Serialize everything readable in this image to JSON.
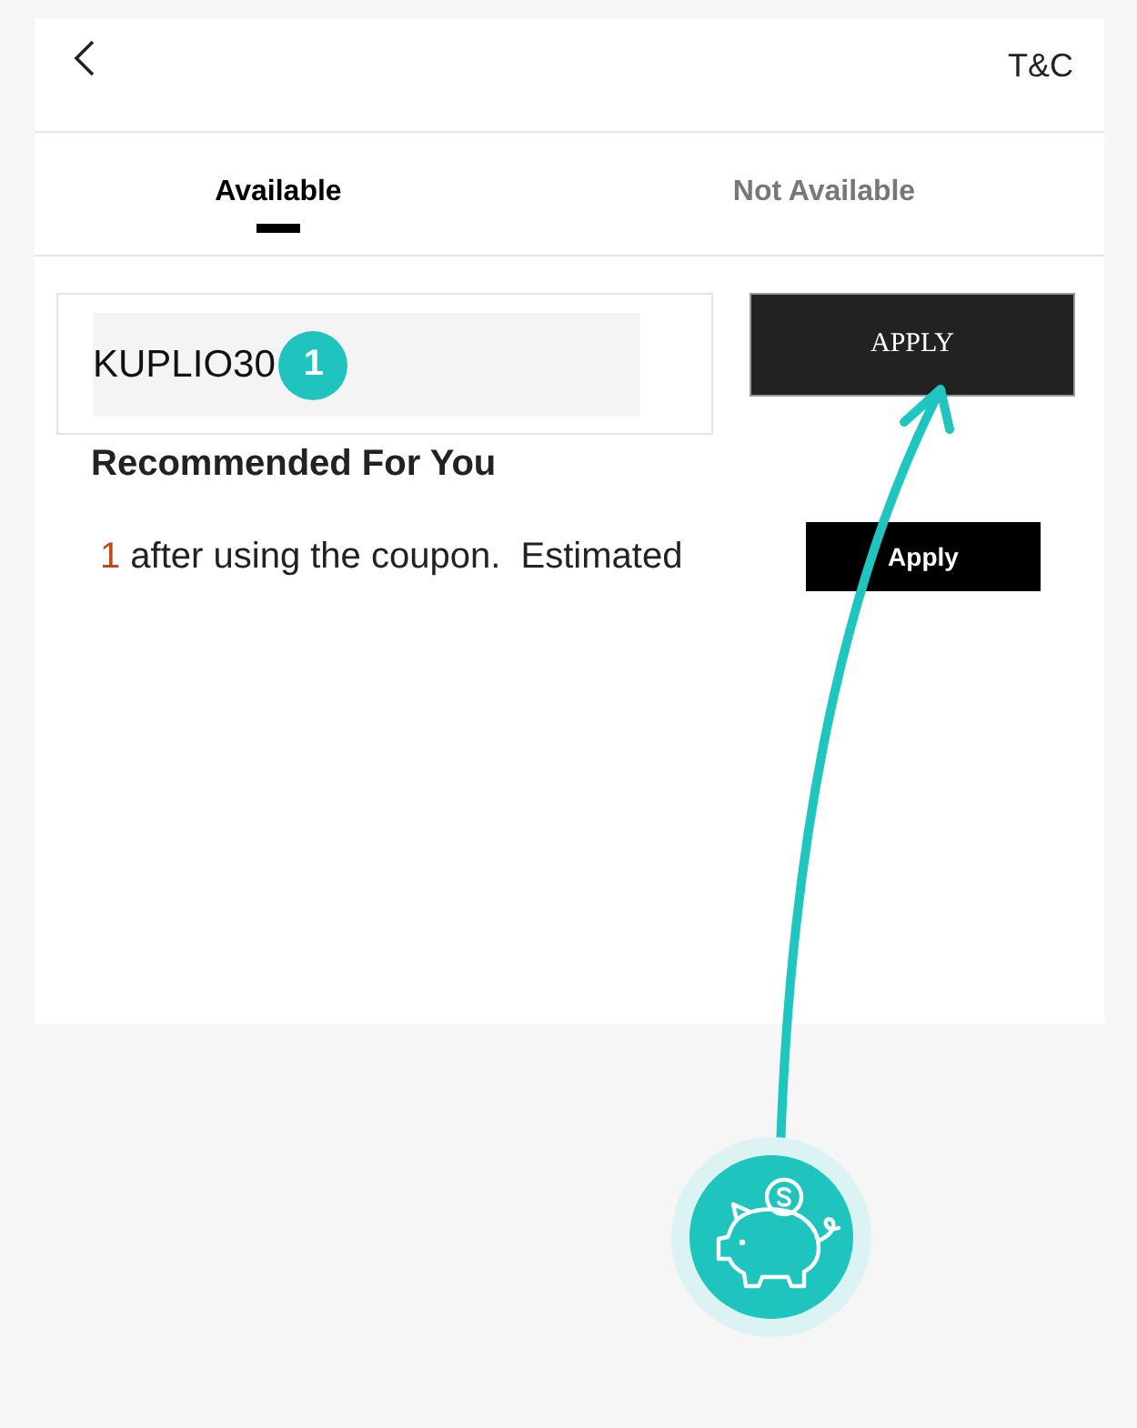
{
  "header": {
    "link": "T&C"
  },
  "tabs": [
    {
      "label": "Available",
      "selected": true
    },
    {
      "label": "Not Available",
      "selected": false
    }
  ],
  "coupon": {
    "value": "KUPLIO30",
    "badge": "1",
    "button": "APPLY"
  },
  "recommended": {
    "heading": "Recommended For You",
    "offers": [
      {
        "amount": "1",
        "text": " after using the coupon.  Estimated",
        "button": "Apply"
      }
    ]
  }
}
